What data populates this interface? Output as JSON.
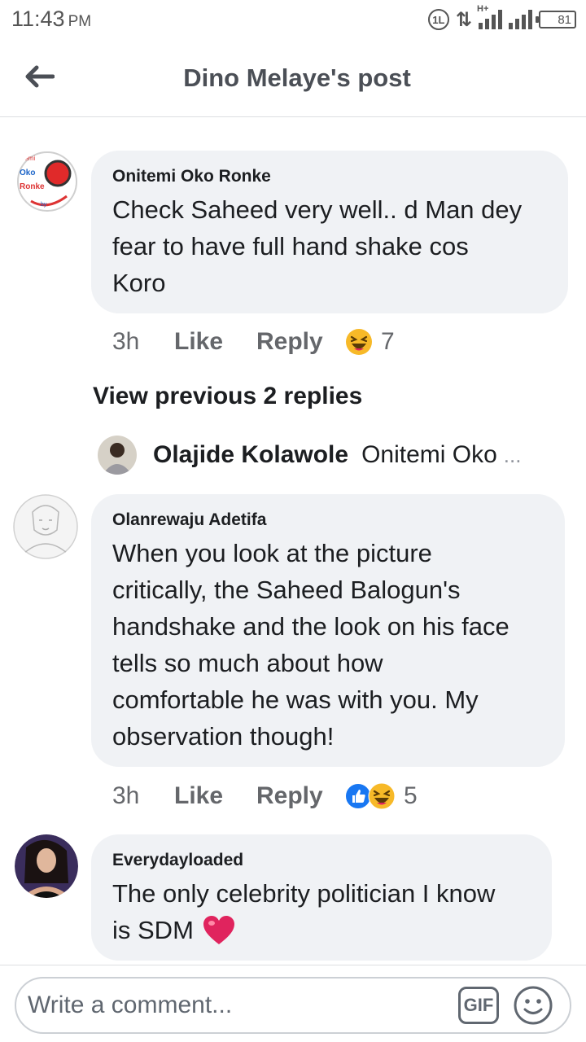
{
  "status_bar": {
    "time": "11:43",
    "ampm": "PM",
    "network_label": "1L",
    "network_type": "H+",
    "battery": "81"
  },
  "header": {
    "title": "Dino Melaye's post"
  },
  "comments": [
    {
      "author": "Onitemi Oko Ronke",
      "lines": [
        "Check Saheed very well.. d Man dey",
        "fear to have full hand shake cos",
        "Koro"
      ],
      "avatar_text": [
        "temi",
        "Oko",
        "Ronke",
        "by"
      ],
      "time": "3h",
      "like": "Like",
      "reply": "Reply",
      "reaction_count": "7"
    },
    {
      "author": "Olanrewaju Adetifa",
      "lines": [
        "When you look at the picture",
        "critically, the Saheed Balogun's",
        "handshake and the look on his face",
        "tells so much about how",
        "comfortable he was with you. My",
        "observation though!"
      ],
      "time": "3h",
      "like": "Like",
      "reply": "Reply",
      "reaction_count": "5"
    },
    {
      "author": "Everydayloaded",
      "lines": [
        "The only celebrity politician I know",
        "is SDM"
      ]
    }
  ],
  "view_previous": "View previous 2 replies",
  "reply_preview": {
    "name": "Olajide Kolawole",
    "text": "Onitemi Oko",
    "ellipsis": "..."
  },
  "composer": {
    "placeholder": "Write a comment...",
    "gif_label": "GIF"
  },
  "colors": {
    "bubble": "#f0f2f5",
    "secondary_text": "#65676b",
    "like_blue": "#1877f2",
    "haha_yellow": "#f7b928",
    "heart_red": "#e0245e"
  },
  "icons": [
    "back-arrow-icon",
    "haha-emoji-icon",
    "like-thumb-icon",
    "heart-icon",
    "smiley-icon"
  ]
}
